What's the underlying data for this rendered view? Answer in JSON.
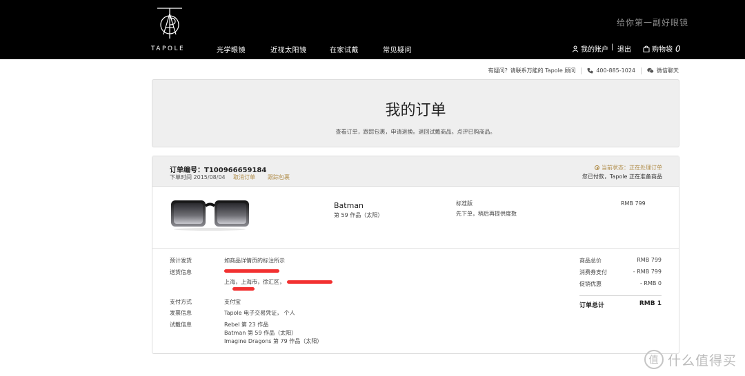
{
  "header": {
    "brand": "TAPOLE",
    "slogan": "给你第一副好眼镜",
    "nav": [
      "光学眼镜",
      "近视太阳镜",
      "在家试戴",
      "常见疑问"
    ],
    "account_label": "我的账户",
    "divider": "|",
    "logout_label": "退出",
    "cart_label": "购物袋",
    "cart_count": "0"
  },
  "helpbar": {
    "question": "有疑问？请联系万能的 Tapole 顾问",
    "phone": "400-885-1024",
    "wechat": "微信聊天"
  },
  "page": {
    "title": "我的订单",
    "subtitle": "查看订单，跟踪包裹，申请退换。退回试戴商品。点评已购商品。"
  },
  "order": {
    "number_label": "订单编号：T100966659184",
    "date_label": "下单时间 2015/08/04",
    "cancel_link": "取消订单",
    "track_link": "跟踪包裹",
    "status": "当前状态：正在处理订单",
    "status_sub": "您已付款，Tapole 正在准备商品",
    "item": {
      "name": "Batman",
      "desc": "第 59 作品（太阳）",
      "version": "标准版",
      "note": "先下单，稍后再提供度数",
      "price": "RMB 799"
    },
    "details": {
      "ship_label": "预计发货",
      "ship_value": "如商品详情页的标注所示",
      "address_label": "送货信息",
      "address_value": "上海，上海市，徐汇区，",
      "payment_label": "支付方式",
      "payment_value": "支付宝",
      "invoice_label": "发票信息",
      "invoice_value": "Tapole 电子交易凭证， 个人",
      "trial_label": "试戴信息",
      "trial_items": [
        "Rebel 第 23 作品",
        "Batman 第 59 作品（太阳）",
        "Imagine Dragons 第 79 作品（太阳）"
      ]
    },
    "summary": {
      "subtotal_label": "商品总价",
      "subtotal_value": "RMB 799",
      "voucher_label": "消费券支付",
      "voucher_value": "- RMB 799",
      "promo_label": "促销优惠",
      "promo_value": "- RMB 0",
      "total_label": "订单总计",
      "total_value": "RMB 1"
    }
  },
  "watermark": {
    "icon_text": "值",
    "text": "什么值得买"
  }
}
